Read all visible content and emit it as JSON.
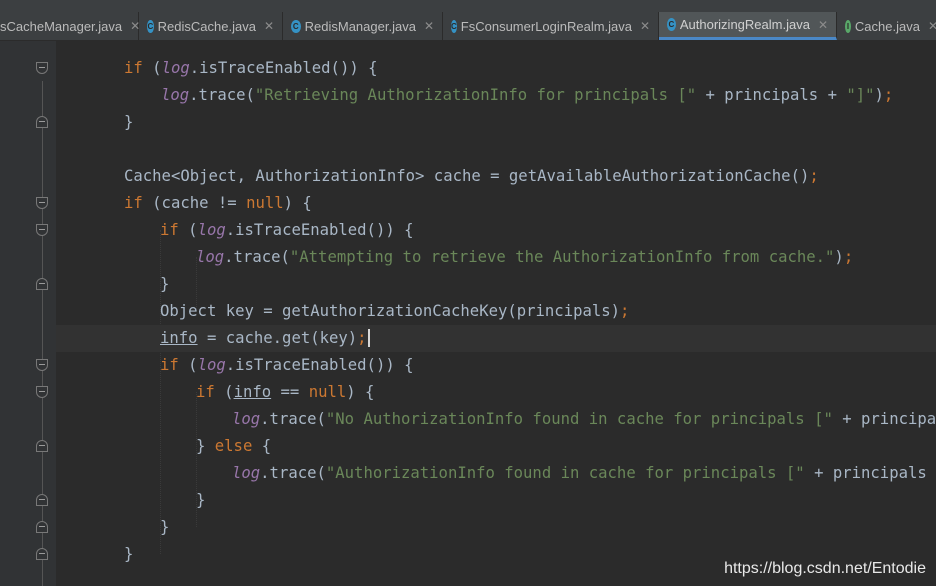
{
  "tabs": [
    {
      "label": "sCacheManager.java",
      "icon": "class-icon",
      "color": "#3592c4"
    },
    {
      "label": "RedisCache.java",
      "icon": "class-icon",
      "color": "#3592c4"
    },
    {
      "label": "RedisManager.java",
      "icon": "class-icon",
      "color": "#3592c4"
    },
    {
      "label": "FsConsumerLoginRealm.java",
      "icon": "class-icon",
      "color": "#3592c4"
    },
    {
      "label": "AuthorizingRealm.java",
      "icon": "class-icon",
      "color": "#3592c4",
      "active": true
    },
    {
      "label": "Cache.java",
      "icon": "interface-icon",
      "color": "#59a869"
    }
  ],
  "code": {
    "l1": {
      "kw": "if",
      "p1": " (",
      "fld": "log",
      "p2": ".isTraceEnabled()) {"
    },
    "l2": {
      "fld": "log",
      "p1": ".trace(",
      "str": "\"Retrieving AuthorizationInfo for principals [\"",
      "p2": " + principals + ",
      "str2": "\"]\"",
      "p3": ")",
      "semi": ";"
    },
    "l3": {
      "p1": "}"
    },
    "l5": {
      "p1": "Cache<Object, AuthorizationInfo> cache = getAvailableAuthorizationCache()",
      "semi": ";"
    },
    "l6": {
      "kw": "if",
      "p1": " (cache != ",
      "kw2": "null",
      "p2": ") {"
    },
    "l7": {
      "kw": "if",
      "p1": " (",
      "fld": "log",
      "p2": ".isTraceEnabled()) {"
    },
    "l8": {
      "fld": "log",
      "p1": ".trace(",
      "str": "\"Attempting to retrieve the AuthorizationInfo from cache.\"",
      "p2": ")",
      "semi": ";"
    },
    "l9": {
      "p1": "}"
    },
    "l10": {
      "p1": "Object key = getAuthorizationCacheKey(principals)",
      "semi": ";"
    },
    "l11": {
      "var": "info",
      "p1": " = cache.get(key)",
      "semi": ";"
    },
    "l12": {
      "kw": "if",
      "p1": " (",
      "fld": "log",
      "p2": ".isTraceEnabled()) {"
    },
    "l13": {
      "kw": "if",
      "p1": " (",
      "var": "info",
      "p2": " == ",
      "kw2": "null",
      "p3": ") {"
    },
    "l14": {
      "fld": "log",
      "p1": ".trace(",
      "str": "\"No AuthorizationInfo found in cache for principals [\"",
      "p2": " + principals + "
    },
    "l15": {
      "p1": "} ",
      "kw": "else",
      "p2": " {"
    },
    "l16": {
      "fld": "log",
      "p1": ".trace(",
      "str": "\"AuthorizationInfo found in cache for principals [\"",
      "p2": " + principals + ",
      "str2": "\"]"
    },
    "l17": {
      "p1": "}"
    },
    "l18": {
      "p1": "}"
    },
    "l19": {
      "p1": "}"
    }
  },
  "watermark": "https://blog.csdn.net/Entodie"
}
